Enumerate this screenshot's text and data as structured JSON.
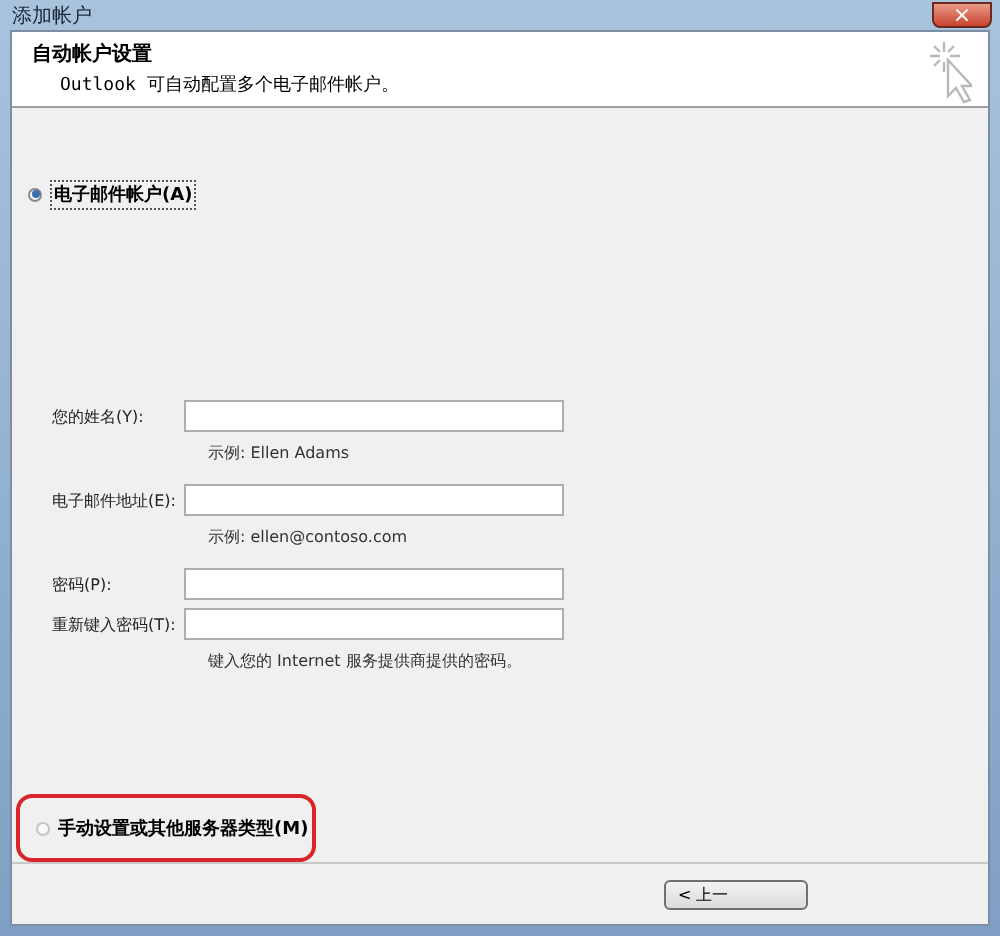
{
  "window": {
    "title": "添加帐户",
    "close": "×"
  },
  "header": {
    "title": "自动帐户设置",
    "subtitle": "Outlook 可自动配置多个电子邮件帐户。"
  },
  "options": [
    {
      "label": "电子邮件帐户(A)",
      "selected": true,
      "highlighted": false
    },
    {
      "label": "手动设置或其他服务器类型(M)",
      "selected": false,
      "highlighted": true
    }
  ],
  "fields": [
    {
      "label": "您的姓名(Y):",
      "hint": "示例: Ellen Adams"
    },
    {
      "label": "电子邮件地址(E):",
      "hint": "示例: ellen@contoso.com"
    },
    {
      "label": "密码(P):"
    },
    {
      "label": "重新键入密码(T):",
      "hint": "键入您的 Internet 服务提供商提供的密码。"
    }
  ],
  "buttons": [
    {
      "label": "< 上一"
    }
  ]
}
